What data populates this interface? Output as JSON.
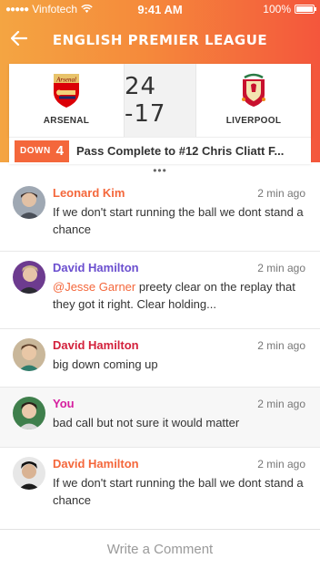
{
  "status_bar": {
    "carrier": "Vinfotech",
    "time": "9:41 AM",
    "battery": "100%"
  },
  "nav": {
    "title": "ENGLISH PREMIER LEAGUE"
  },
  "match": {
    "home": {
      "name": "ARSENAL",
      "crest_text": "Arsenal"
    },
    "away": {
      "name": "LIVERPOOL"
    },
    "score": "24 -17"
  },
  "play": {
    "down_label": "DOWN",
    "down_number": "4",
    "text": "Pass Complete to #12 Chris Cliatt F..."
  },
  "comments": [
    {
      "name": "Leonard Kim",
      "name_color": "#f4673b",
      "time": "2 min ago",
      "mention": "",
      "text": "If we don't start running the ball we dont stand a chance"
    },
    {
      "name": "David Hamilton",
      "name_color": "#6b4fcf",
      "time": "2 min ago",
      "mention": "@Jesse Garner",
      "text": " preety clear on the replay that they got it right. Clear holding..."
    },
    {
      "name": "David Hamilton",
      "name_color": "#d3213c",
      "time": "2 min ago",
      "mention": "",
      "text": "big down coming up"
    },
    {
      "name": "You",
      "name_color": "#d61e9f",
      "time": "2 min ago",
      "mention": "",
      "text": "bad call but not sure it would matter"
    },
    {
      "name": "David Hamilton",
      "name_color": "#f4673b",
      "time": "2 min ago",
      "mention": "",
      "text": "If we don't start running the ball we dont stand a chance"
    }
  ],
  "compose": {
    "placeholder": "Write a Comment"
  },
  "colors": {
    "accent": "#f4673b",
    "gradient_start": "#f4a542",
    "gradient_end": "#f4563c"
  }
}
